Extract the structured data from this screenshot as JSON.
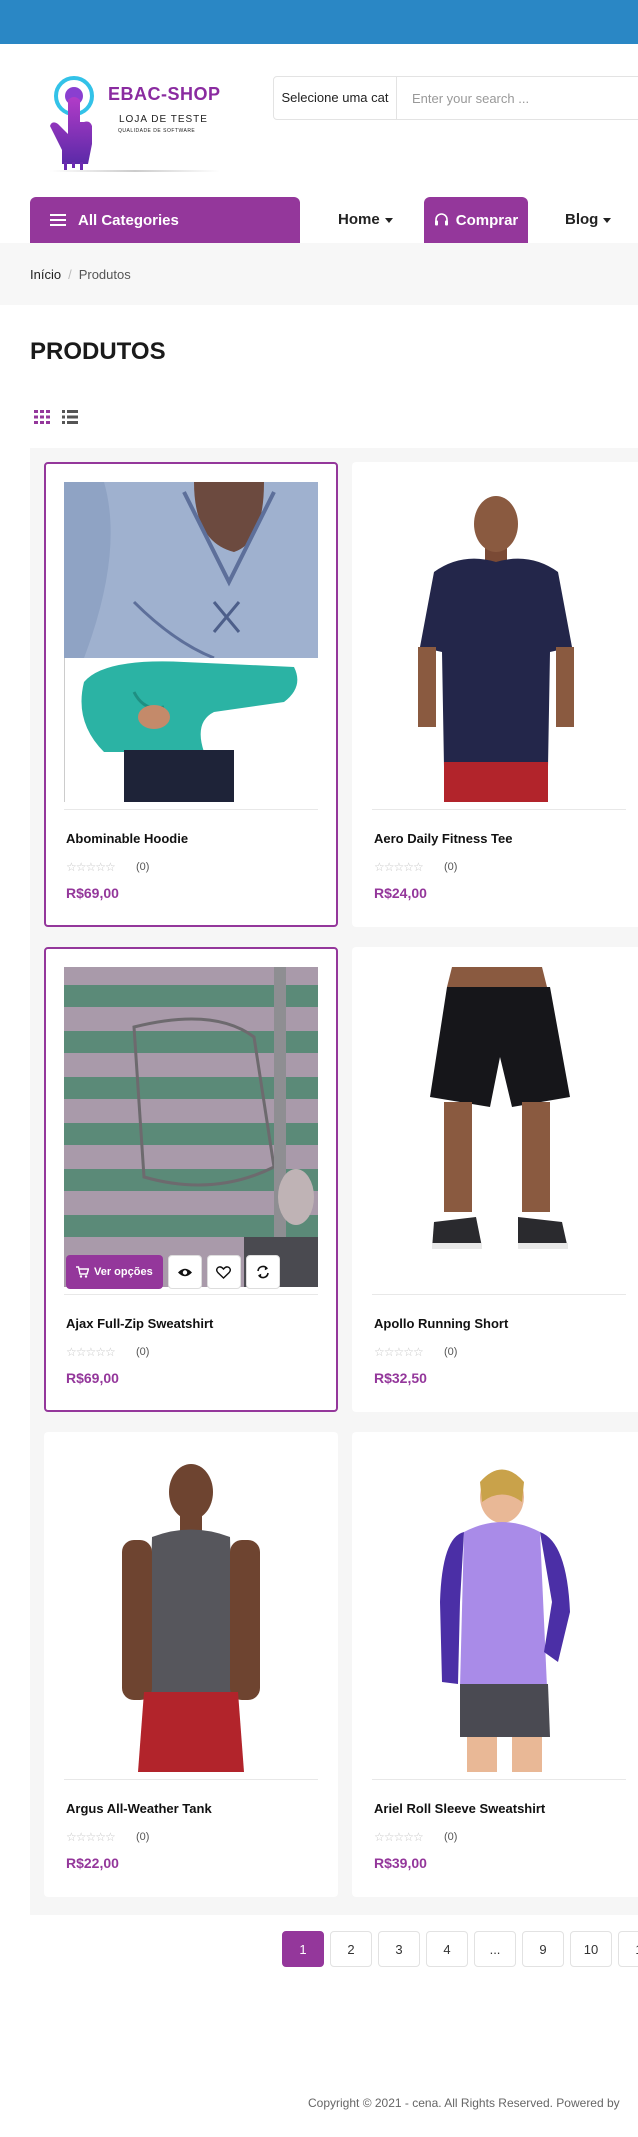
{
  "logo": {
    "title": "EBAC-SHOP",
    "subtitle": "LOJA DE TESTE",
    "tagline": "QUALIDADE DE SOFTWARE"
  },
  "search": {
    "category_label": "Selecione uma cat",
    "placeholder": "Enter your search ..."
  },
  "nav": {
    "all_categories": "All Categories",
    "home": "Home",
    "comprar": "Comprar",
    "blog": "Blog"
  },
  "breadcrumb": {
    "home": "Início",
    "separator": "/",
    "current": "Produtos"
  },
  "page": {
    "title": "PRODUTOS"
  },
  "colors": {
    "accent": "#94379b",
    "topbar": "#2a87c5"
  },
  "products": [
    {
      "name": "Abominable Hoodie",
      "rating_stars": "☆☆☆☆☆",
      "reviews": "(0)",
      "price": "R$69,00"
    },
    {
      "name": "Aero Daily Fitness Tee",
      "rating_stars": "☆☆☆☆☆",
      "reviews": "(0)",
      "price": "R$24,00"
    },
    {
      "name": "Ajax Full-Zip Sweatshirt",
      "rating_stars": "☆☆☆☆☆",
      "reviews": "(0)",
      "price": "R$69,00"
    },
    {
      "name": "Apollo Running Short",
      "rating_stars": "☆☆☆☆☆",
      "reviews": "(0)",
      "price": "R$32,50"
    },
    {
      "name": "Argus All-Weather Tank",
      "rating_stars": "☆☆☆☆☆",
      "reviews": "(0)",
      "price": "R$22,00"
    },
    {
      "name": "Ariel Roll Sleeve Sweatshirt",
      "rating_stars": "☆☆☆☆☆",
      "reviews": "(0)",
      "price": "R$39,00"
    }
  ],
  "hover_actions": {
    "ver_opcoes": "Ver opções"
  },
  "pagination": [
    "1",
    "2",
    "3",
    "4",
    "...",
    "9",
    "10",
    "1"
  ],
  "footer": {
    "text": "Copyright © 2021 - cena. All Rights Reserved. Powered by"
  }
}
